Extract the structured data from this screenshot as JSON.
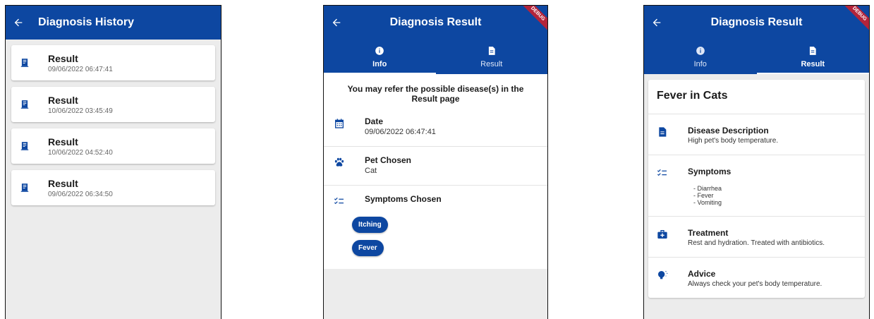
{
  "colors": {
    "primary": "#0d47a1",
    "background": "#ececec",
    "debug_banner": "#b3243a"
  },
  "history": {
    "title": "Diagnosis History",
    "items": [
      {
        "title": "Result",
        "date": "09/06/2022 06:47:41",
        "icon": "receipt-icon"
      },
      {
        "title": "Result",
        "date": "10/06/2022 03:45:49",
        "icon": "receipt-icon"
      },
      {
        "title": "Result",
        "date": "10/06/2022 04:52:40",
        "icon": "receipt-icon"
      },
      {
        "title": "Result",
        "date": "09/06/2022 06:34:50",
        "icon": "receipt-icon"
      }
    ]
  },
  "result_info": {
    "title": "Diagnosis Result",
    "debug_label": "DEBUG",
    "tabs": [
      {
        "label": "Info",
        "icon": "info-icon"
      },
      {
        "label": "Result",
        "icon": "document-icon"
      }
    ],
    "heading": "You may refer the possible disease(s) in the Result page",
    "date_label": "Date",
    "date_value": "09/06/2022 06:47:41",
    "pet_label": "Pet Chosen",
    "pet_value": "Cat",
    "symptoms_label": "Symptoms Chosen",
    "symptoms": [
      "Itching",
      "Fever"
    ]
  },
  "result_detail": {
    "title": "Diagnosis Result",
    "debug_label": "DEBUG",
    "tabs": [
      {
        "label": "Info",
        "icon": "info-icon"
      },
      {
        "label": "Result",
        "icon": "document-icon"
      }
    ],
    "disease": "Fever in Cats",
    "description_label": "Disease Description",
    "description_value": "High pet's body temperature.",
    "symptoms_label": "Symptoms",
    "symptoms": [
      "- Diarrhea",
      "- Fever",
      "- Vomiting"
    ],
    "treatment_label": "Treatment",
    "treatment_value": "Rest and hydration. Treated with antibiotics.",
    "advice_label": "Advice",
    "advice_value": "Always check your pet's body temperature."
  }
}
